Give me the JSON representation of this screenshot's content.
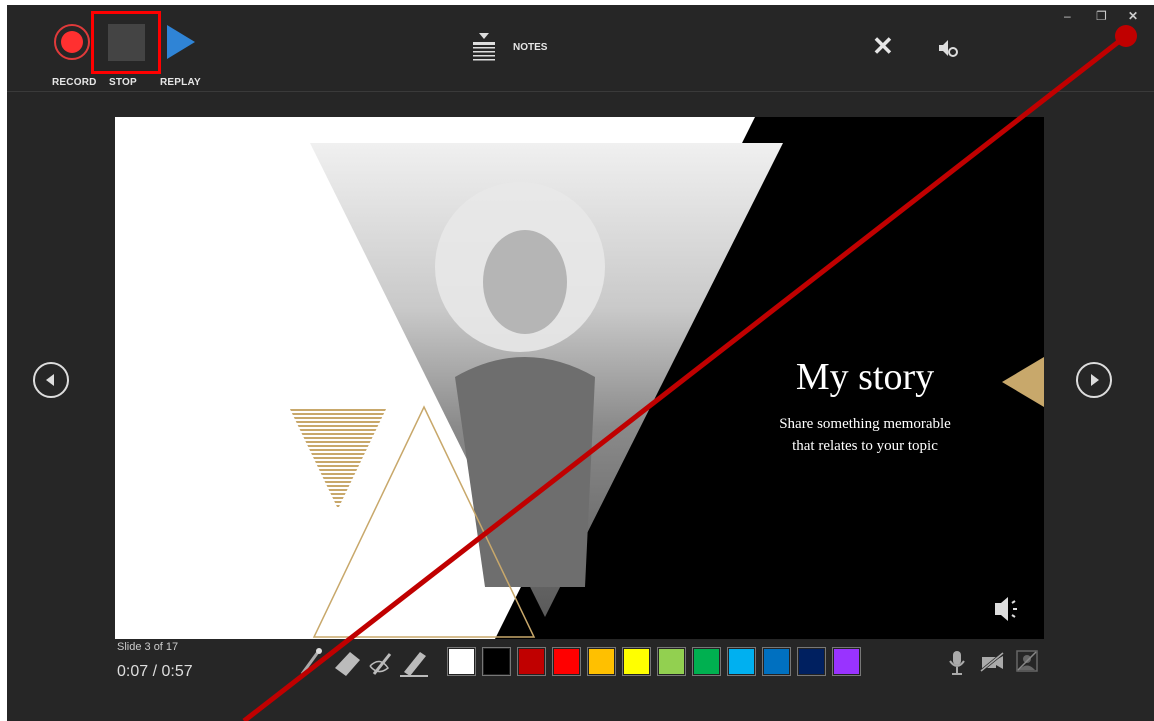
{
  "toolbar": {
    "record_label": "RECORD",
    "stop_label": "STOP",
    "replay_label": "REPLAY",
    "notes_label": "NOTES"
  },
  "slide": {
    "title": "My story",
    "subtitle_line1": "Share something memorable",
    "subtitle_line2": "that relates to your topic"
  },
  "status": {
    "slide_counter": "Slide 3 of 17",
    "timer": "0:07 / 0:57"
  },
  "pen_colors": [
    "#ffffff",
    "#000000",
    "#c00000",
    "#ff0000",
    "#ffc000",
    "#ffff00",
    "#92d050",
    "#00b050",
    "#00b0f0",
    "#0070c0",
    "#002060",
    "#9933ff"
  ],
  "icons": [
    "record-icon",
    "stop-icon",
    "replay-icon",
    "notes-icon",
    "close-icon",
    "audio-settings-icon",
    "minimize-icon",
    "restore-icon",
    "close-window-icon",
    "prev-slide-icon",
    "next-slide-icon",
    "laser-pointer-icon",
    "eraser-icon",
    "pen-icon",
    "highlighter-icon",
    "microphone-icon",
    "camera-off-icon",
    "camera-preview-off-icon",
    "speaker-icon"
  ],
  "colors": {
    "annotation_line": "#c00000",
    "accent_gold": "#c8a86b"
  }
}
